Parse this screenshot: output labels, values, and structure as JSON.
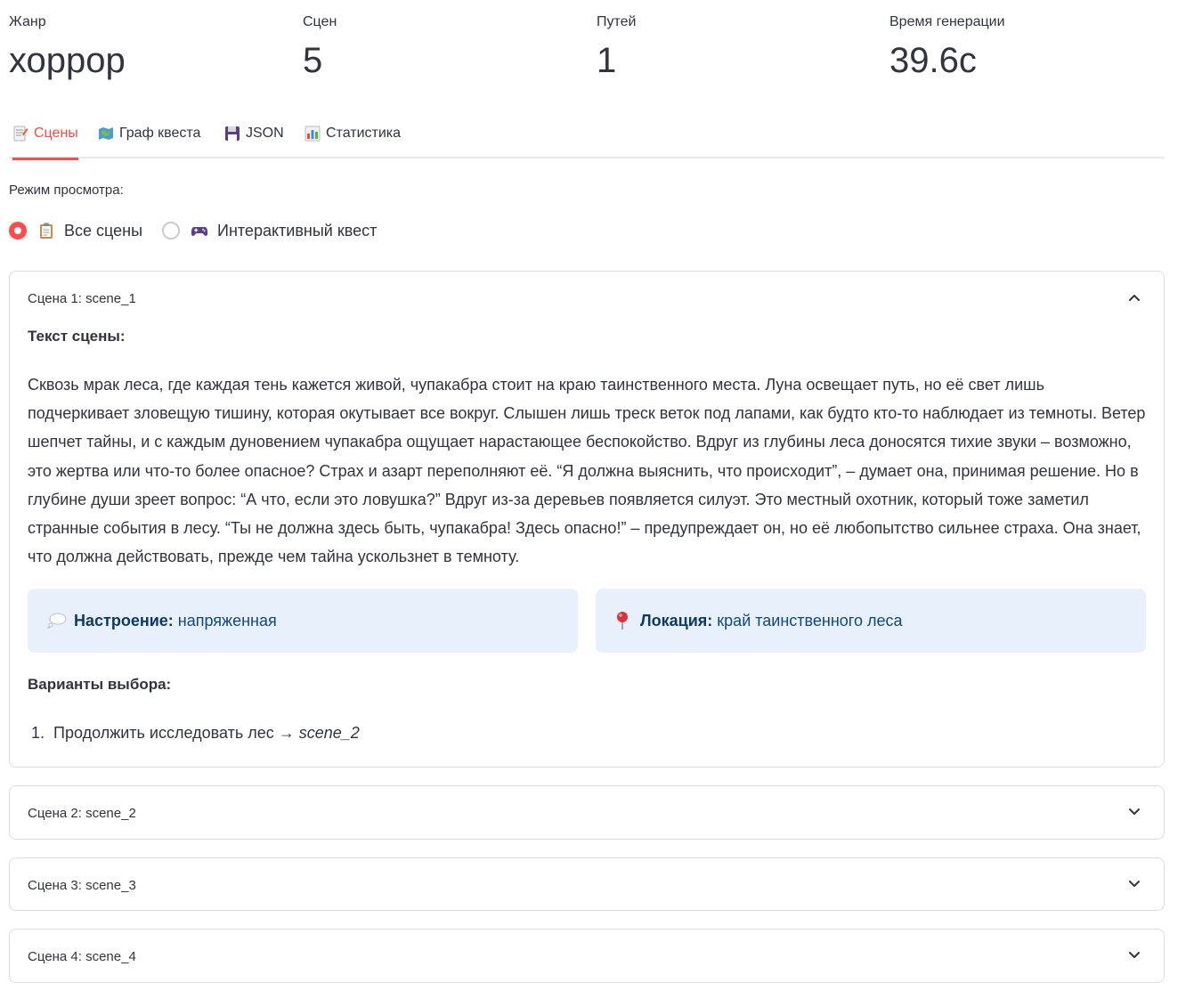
{
  "metrics": [
    {
      "label": "Жанр",
      "value": "хоррор"
    },
    {
      "label": "Сцен",
      "value": "5"
    },
    {
      "label": "Путей",
      "value": "1"
    },
    {
      "label": "Время генерации",
      "value": "39.6с"
    }
  ],
  "tabs": [
    {
      "label": "Сцены",
      "icon": "memo-icon",
      "active": true
    },
    {
      "label": "Граф квеста",
      "icon": "map-icon",
      "active": false
    },
    {
      "label": "JSON",
      "icon": "floppy-disk-icon",
      "active": false
    },
    {
      "label": "Статистика",
      "icon": "bar-chart-icon",
      "active": false
    }
  ],
  "view_mode": {
    "label": "Режим просмотра:",
    "options": [
      {
        "label": "Все сцены",
        "icon": "clipboard-icon",
        "selected": true
      },
      {
        "label": "Интерактивный квест",
        "icon": "gamepad-icon",
        "selected": false
      }
    ]
  },
  "scenes": [
    {
      "title": "Сцена 1: scene_1",
      "expanded": true,
      "text_heading": "Текст сцены:",
      "text": "Сквозь мрак леса, где каждая тень кажется живой, чупакабра стоит на краю таинственного места. Луна освещает путь, но её свет лишь подчеркивает зловещую тишину, которая окутывает все вокруг. Слышен лишь треск веток под лапами, как будто кто-то наблюдает из темноты. Ветер шепчет тайны, и с каждым дуновением чупакабра ощущает нарастающее беспокойство. Вдруг из глубины леса доносятся тихие звуки – возможно, это жертва или что-то более опасное? Страх и азарт переполняют её. “Я должна выяснить, что происходит”, – думает она, принимая решение. Но в глубине души зреет вопрос: “А что, если это ловушка?” Вдруг из-за деревьев появляется силуэт. Это местный охотник, который тоже заметил странные события в лесу. “Ты не должна здесь быть, чупакабра! Здесь опасно!” – предупреждает он, но её любопытство сильнее страха. Она знает, что должна действовать, прежде чем тайна ускользнет в темноту.",
      "mood_label": "Настроение:",
      "mood_value": "напряженная",
      "location_label": "Локация:",
      "location_value": "край таинственного леса",
      "choices_heading": "Варианты выбора:",
      "choices": [
        {
          "num": "1.",
          "text": "Продолжить исследовать лес",
          "arrow": "→",
          "target": "scene_2"
        }
      ]
    },
    {
      "title": "Сцена 2: scene_2",
      "expanded": false
    },
    {
      "title": "Сцена 3: scene_3",
      "expanded": false
    },
    {
      "title": "Сцена 4: scene_4",
      "expanded": false
    }
  ],
  "colors": {
    "accent": "#ff4b4b",
    "info_bg": "#e8f1fb",
    "info_text": "#0d4a7a",
    "border": "#dcdde2",
    "text": "#31333f"
  }
}
